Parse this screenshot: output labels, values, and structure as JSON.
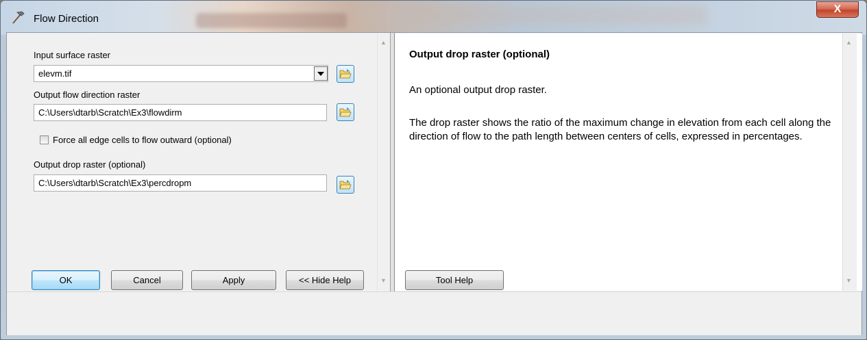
{
  "window": {
    "title": "Flow Direction",
    "close_glyph": "X"
  },
  "form": {
    "input_surface_label": "Input surface raster",
    "input_surface_value": "elevm.tif",
    "output_flow_label": "Output flow direction raster",
    "output_flow_value": "C:\\Users\\dtarb\\Scratch\\Ex3\\flowdirm",
    "force_edge_label": "Force all edge cells to flow outward (optional)",
    "force_edge_checked": false,
    "drop_raster_label": "Output drop raster (optional)",
    "drop_raster_value": "C:\\Users\\dtarb\\Scratch\\Ex3\\percdropm"
  },
  "help": {
    "title": "Output drop raster (optional)",
    "para1": "An optional output drop raster.",
    "para2": "The drop raster shows the ratio of the maximum change in elevation from each cell along the direction of flow to the path length between centers of cells, expressed in percentages."
  },
  "buttons": {
    "ok": "OK",
    "cancel": "Cancel",
    "apply": "Apply",
    "hide_help": "<< Hide Help",
    "tool_help": "Tool Help"
  },
  "icons": {
    "app": "hammer-icon",
    "browse": "open-folder-icon",
    "dropdown": "chevron-down-icon"
  },
  "colors": {
    "close_button": "#c2452c",
    "default_button_border": "#3c7fb1"
  }
}
